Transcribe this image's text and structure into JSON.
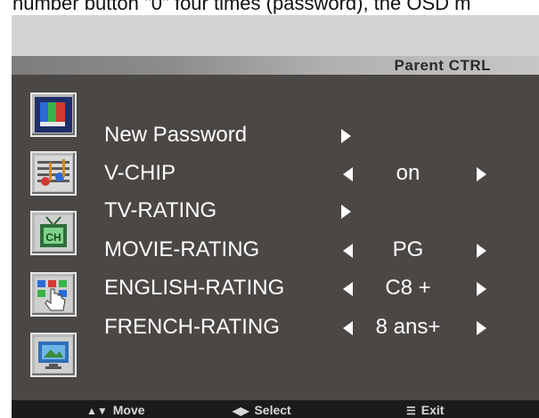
{
  "header_caption": "number button \"0\" four times (password), the OSD m",
  "menu": {
    "title": "Parent CTRL",
    "items": [
      {
        "label": "New Password",
        "value": ""
      },
      {
        "label": "V-CHIP",
        "value": "on"
      },
      {
        "label": "TV-RATING",
        "value": ""
      },
      {
        "label": "MOVIE-RATING",
        "value": "PG"
      },
      {
        "label": "ENGLISH-RATING",
        "value": "C8 +"
      },
      {
        "label": "FRENCH-RATING",
        "value": "8 ans+"
      }
    ]
  },
  "icons": [
    "picture-icon",
    "audio-icon",
    "channel-icon",
    "function-icon",
    "screen-icon"
  ],
  "footer": {
    "move": "Move",
    "select": "Select",
    "exit": "Exit"
  },
  "colors": {
    "panel": "#4a4745",
    "footer": "#1c1b1b",
    "title_bar_gradient": [
      "#7d7d7d",
      "#c6c6c6"
    ]
  }
}
